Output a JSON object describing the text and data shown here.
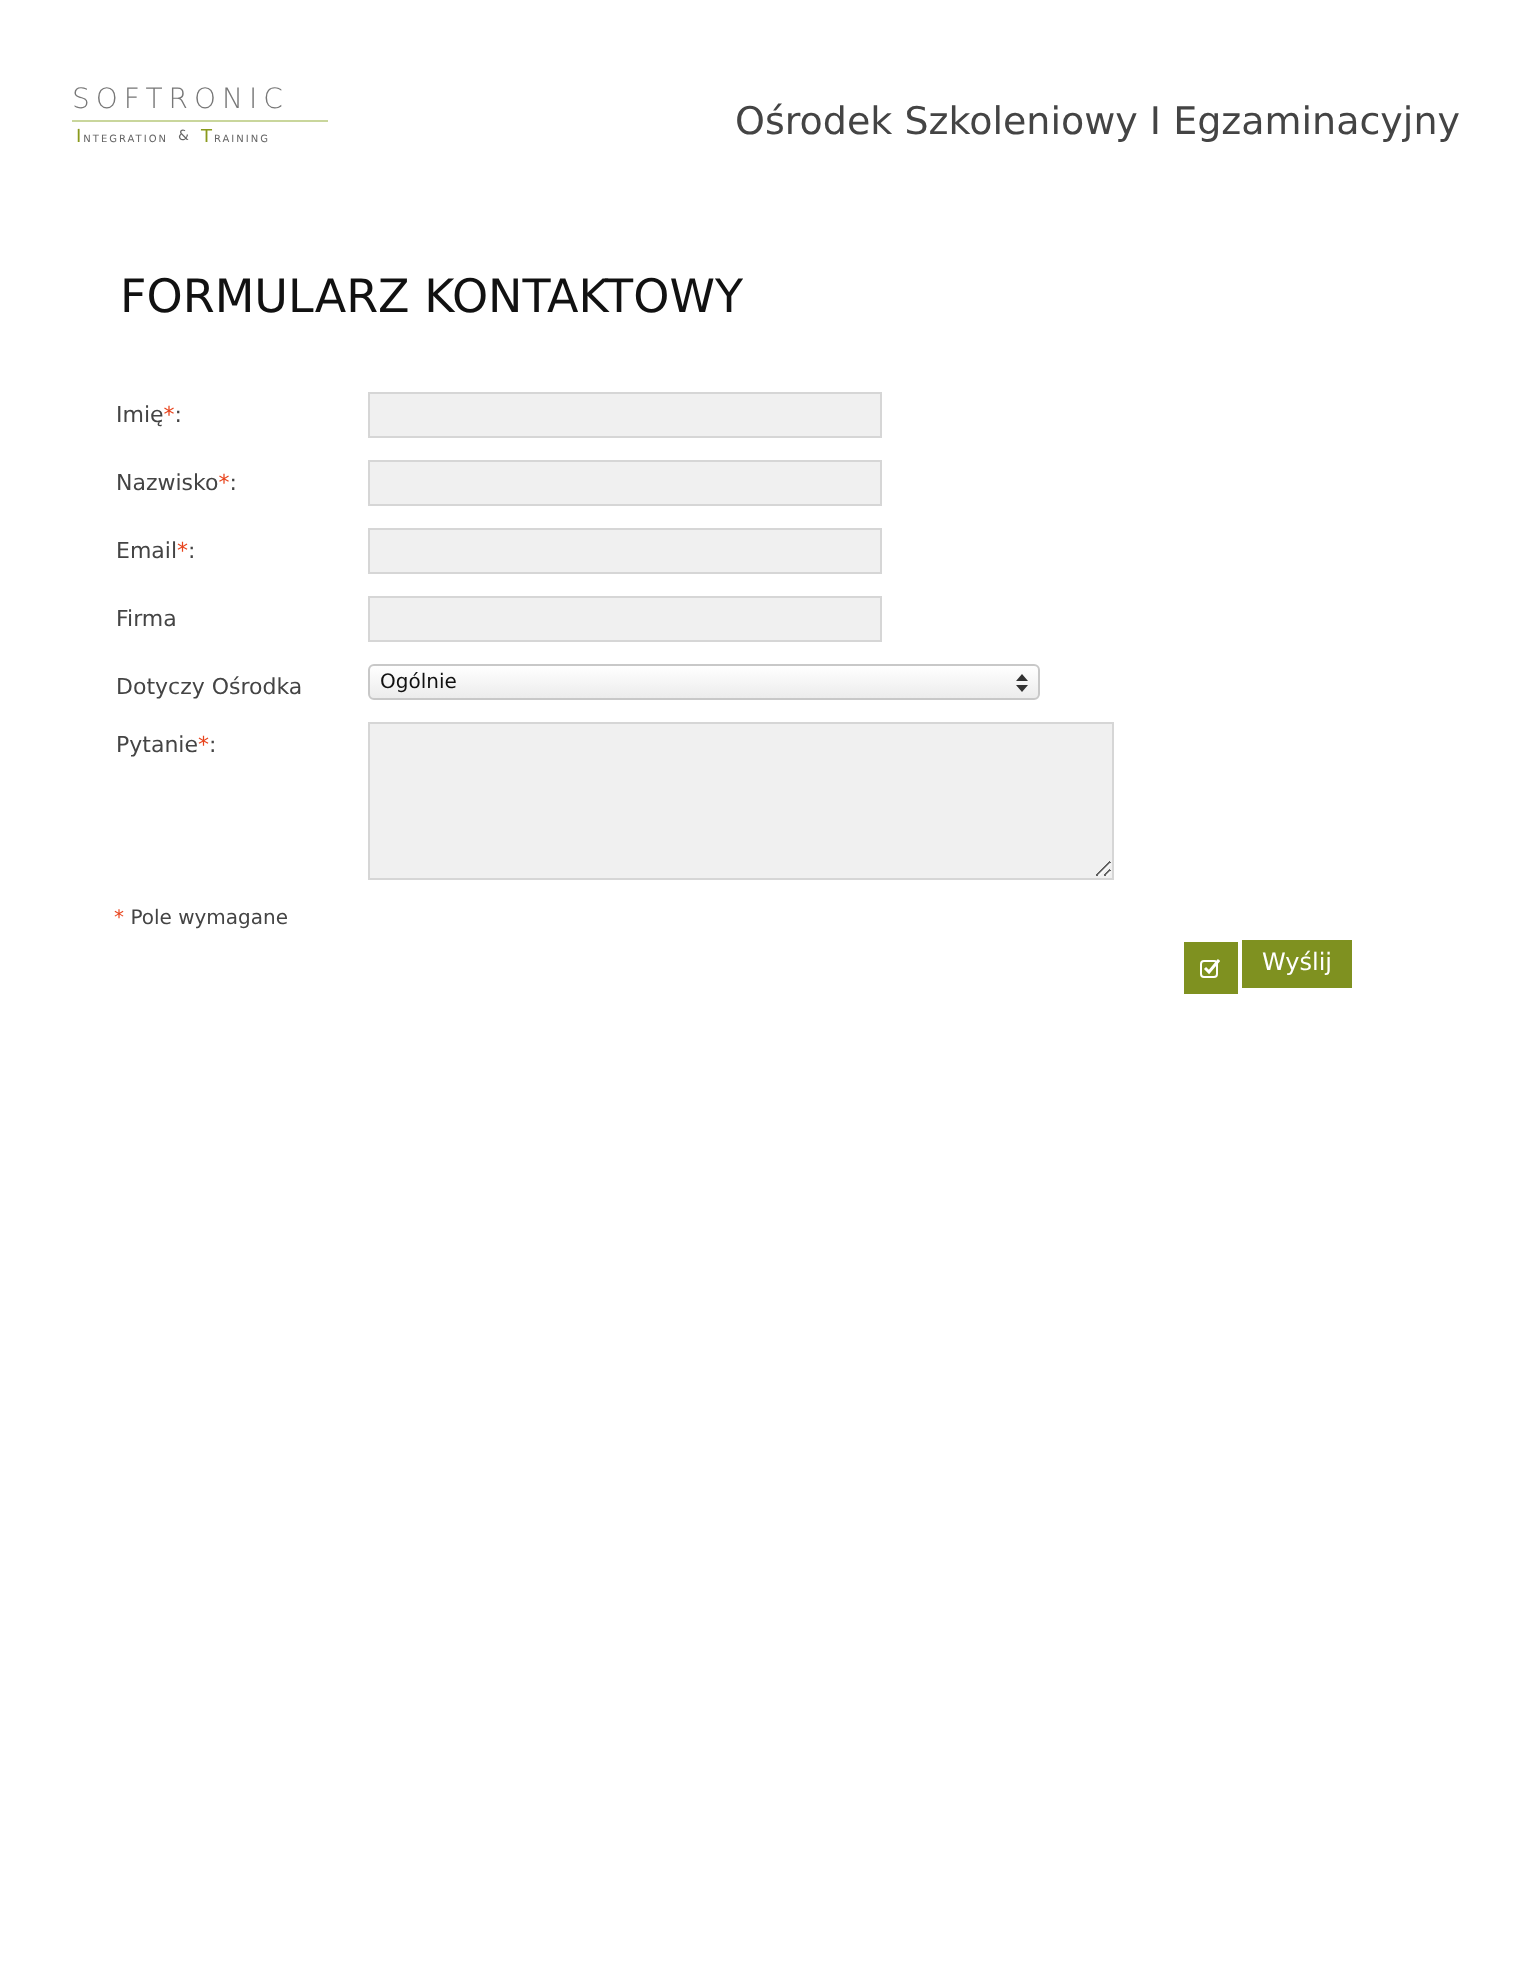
{
  "header": {
    "logo": {
      "name": "SOFTRONIC",
      "tagline": [
        "Integration",
        "&",
        "Training"
      ]
    },
    "title": "Ośrodek Szkoleniowy I Egzaminacyjny"
  },
  "form": {
    "title": "FORMULARZ KONTAKTOWY",
    "fields": [
      {
        "kind": "text",
        "label": "Imię",
        "required_mark": "*",
        "colon": ":"
      },
      {
        "kind": "text",
        "label": "Nazwisko",
        "required_mark": "*",
        "colon": ":"
      },
      {
        "kind": "text",
        "label": "Email",
        "required_mark": "*",
        "colon": ":"
      },
      {
        "kind": "text",
        "label": "Firma"
      },
      {
        "kind": "select",
        "label": "Dotyczy Ośrodka",
        "value": "Ogólnie"
      },
      {
        "kind": "textarea",
        "label": "Pytanie",
        "required_mark": "*",
        "colon": ":"
      }
    ],
    "required_note": {
      "mark": "*",
      "text": "Pole wymagane"
    },
    "submit": {
      "label": "Wyślij"
    }
  }
}
